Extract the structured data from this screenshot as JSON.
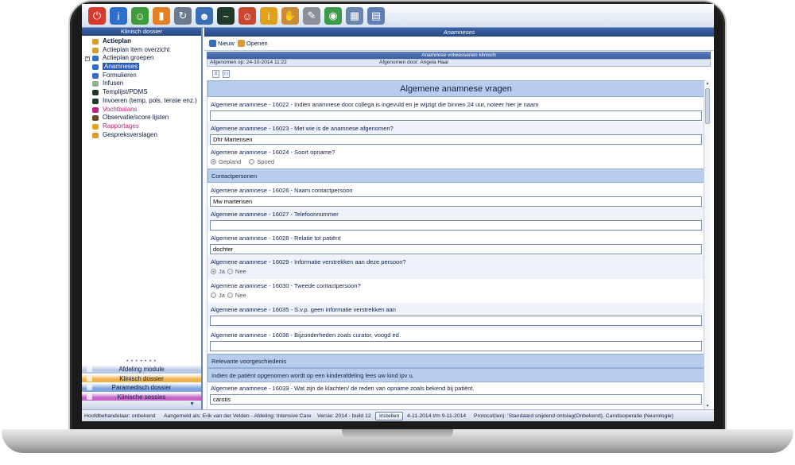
{
  "toolbar": {
    "icons": [
      {
        "name": "power-icon",
        "glyph": "⏻",
        "color": "#d83a2b"
      },
      {
        "name": "info-icon",
        "glyph": "i",
        "color": "#2f6fcc"
      },
      {
        "name": "person-plus-icon",
        "glyph": "☺",
        "color": "#3f9a3a"
      },
      {
        "name": "book-icon",
        "glyph": "▮",
        "color": "#e67e22"
      },
      {
        "name": "refresh-icon",
        "glyph": "↻",
        "color": "#6c7a8f"
      },
      {
        "name": "users-icon",
        "glyph": "☻",
        "color": "#3a6fb5"
      },
      {
        "name": "monitor-icon",
        "glyph": "~",
        "color": "#1f3a2a"
      },
      {
        "name": "person-red-icon",
        "glyph": "☺",
        "color": "#c9462f"
      },
      {
        "name": "person-info-icon",
        "glyph": "i",
        "color": "#e0a21a"
      },
      {
        "name": "handshake-icon",
        "glyph": "✋",
        "color": "#c98a3a"
      },
      {
        "name": "paperclip-icon",
        "glyph": "✎",
        "color": "#8a8f99"
      },
      {
        "name": "globe-icon",
        "glyph": "◉",
        "color": "#3c9a4a"
      },
      {
        "name": "network-icon",
        "glyph": "▦",
        "color": "#6a86b0"
      },
      {
        "name": "building-icon",
        "glyph": "▤",
        "color": "#5f7fb4"
      }
    ]
  },
  "sidebar": {
    "title": "Klinisch dossier",
    "items": [
      {
        "label": "Actieplan",
        "style": "bold",
        "icon": "#d99b2a",
        "expander": ""
      },
      {
        "label": "Actieplan item overzicht",
        "style": "",
        "icon": "#d99b2a",
        "expander": ""
      },
      {
        "label": "Actieplan groepen",
        "style": "",
        "icon": "#2f6fcc",
        "expander": "+"
      },
      {
        "label": "Anamneses",
        "style": "selected",
        "icon": "#2f6fcc",
        "expander": ""
      },
      {
        "label": "Formulieren",
        "style": "",
        "icon": "#2f6fcc",
        "expander": ""
      },
      {
        "label": "Infusen",
        "style": "",
        "icon": "#8fb08f",
        "expander": ""
      },
      {
        "label": "Templijst/PDMS",
        "style": "",
        "icon": "#1f3a2a",
        "expander": ""
      },
      {
        "label": "Invoeren (temp, pols, tensie enz.)",
        "style": "",
        "icon": "#1f3a2a",
        "expander": ""
      },
      {
        "label": "Vochtbalans",
        "style": "pink",
        "icon": "#c0237f",
        "expander": ""
      },
      {
        "label": "Observatie/score lijsten",
        "style": "",
        "icon": "#6b4a2a",
        "expander": ""
      },
      {
        "label": "Rapportages",
        "style": "pink",
        "icon": "#e0a21a",
        "expander": ""
      },
      {
        "label": "Gespreksverslagen",
        "style": "",
        "icon": "#d99b2a",
        "expander": ""
      }
    ],
    "modules": [
      {
        "label": "Afdeling module",
        "color": "#b8c9e6"
      },
      {
        "label": "Klinisch dossier",
        "color": "#f0b24a"
      },
      {
        "label": "Paramedisch dossier",
        "color": "#7fa5e0"
      },
      {
        "label": "Klinische sessies",
        "color": "#c565c9"
      }
    ]
  },
  "main": {
    "title": "Anamneses",
    "actions": [
      {
        "label": "Nieuw",
        "icon": "#3a6fb5"
      },
      {
        "label": "Openen",
        "icon": "#d99b2a"
      }
    ],
    "subtitle": "Anamnese volwassenen klinisch",
    "taken_on": "Afgenomen op: 24-10-2014 11:22",
    "taken_by": "Afgenomen door: Angela Haar"
  },
  "form": {
    "title": "Algemene anamnese vragen",
    "q16022": {
      "label": "Algemene anamnese - 16022 - Indien anamnese door collega is ingevuld en je wijzigt die binnen 24 uur, noteer hier je naam",
      "value": ""
    },
    "q16023": {
      "label": "Algemene anamnese - 16023 - Met wie is de anamnese afgenomen?",
      "value": "Dhr Martensen"
    },
    "q16024": {
      "label": "Algemene anamnese - 16024 - Soort opname?",
      "opt1": "Gepland",
      "opt2": "Spoed"
    },
    "contacts_header": "Contactpersonen",
    "q16026": {
      "label": "Algemene anamnese - 16026 - Naam contactpersoon",
      "value": "Mw martensen"
    },
    "q16027": {
      "label": "Algemene anamnese - 16027 - Telefoonnummer",
      "value": ""
    },
    "q16028": {
      "label": "Algemene anamnese - 16028 - Relatie tot patiënt",
      "value": "dochter"
    },
    "q16029": {
      "label": "Algemene anamnese - 16029 - Informatie verstrekken aan deze persoon?",
      "opt1": "Ja",
      "opt2": "Nee"
    },
    "q16030": {
      "label": "Algemene anamnese - 16030 - Tweede contactpersoon?",
      "opt1": "Ja",
      "opt2": "Nee"
    },
    "q16035": {
      "label": "Algemene anamnese - 16035 - S.v.p. geen informatie verstrekken aan",
      "value": ""
    },
    "q16036": {
      "label": "Algemene anamnese - 16036 - Bijzonderheden zoals curator, voogd ed.",
      "value": ""
    },
    "history_header": "Relevante voorgeschiedenis",
    "child_note": "Indien de patiënt opgenomen wordt op een kinderafdeling lees uw kind ipv u.",
    "q16039": {
      "label": "Algemene anamnese - 16039 - Wat zijn de klachten/ de reden van opname zoals bekend bij patiënt.",
      "value": "carotis"
    }
  },
  "status": {
    "practitioner": "Hoofdbehandelaar: onbekend",
    "logged_in": "Aangemeld als: Erik van der Velden - Afdeling: Intensive Care",
    "version": "Versie: 2014 - build 12",
    "settings_button": "Instellen",
    "period": "4-11-2014 t/m 9-11-2014",
    "protocols": "Protocol(len): 'Standaard snijdend ontslag(Onbekend), Carotisoperatie (Neurologie)"
  }
}
